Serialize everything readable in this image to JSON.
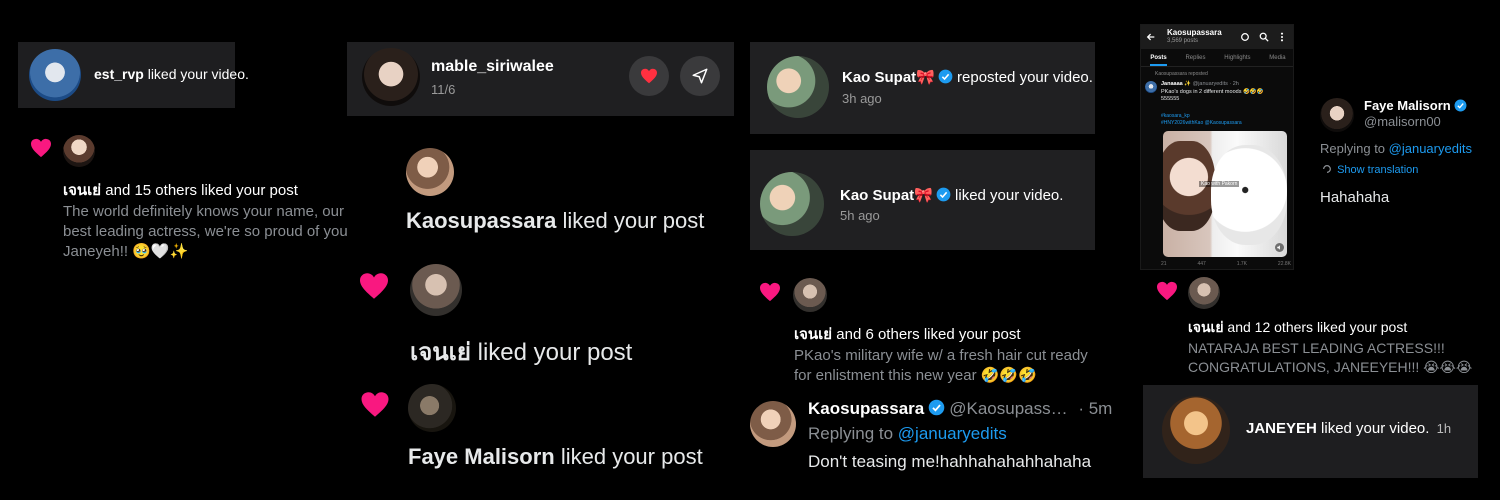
{
  "col1": {
    "toast": {
      "username": "est_rvp",
      "text": " liked your video."
    },
    "like": {
      "names": "เจนเย่",
      "rest": " and 15 others liked your post",
      "body_lines": [
        "The world definitely knows your name, our",
        "best leading actress, we're so proud of you",
        "Janeyeh!! 🥹🤍✨"
      ]
    }
  },
  "col2": {
    "dm": {
      "username": "mable_siriwalee",
      "date": "11/6"
    },
    "like1": {
      "name": "Kaosupassara",
      "rest": " liked your post"
    },
    "like2": {
      "name": "เจนเย่",
      "rest": " liked your post"
    },
    "like3": {
      "name": "Faye Malisorn",
      "rest": " liked your post"
    }
  },
  "col3": {
    "repost": {
      "name": "Kao Supat🎀",
      "rest": " reposted your video.",
      "time": "3h ago"
    },
    "liked": {
      "name": "Kao Supat🎀",
      "rest": " liked your video.",
      "time": "5h ago"
    },
    "like": {
      "names": "เจนเย่",
      "rest": " and 6 others liked your post",
      "body_lines": [
        "PKao's military wife w/ a fresh hair cut ready",
        "for enlistment this new year 🤣🤣🤣"
      ]
    },
    "reply": {
      "name": "Kaosupassara",
      "handle": "@Kaosupass…",
      "time": "· 5m",
      "replying": "Replying to ",
      "replying_handle": "@januaryedits",
      "text": "Don't teasing me!hahhahahahhahaha"
    }
  },
  "col4": {
    "profile": {
      "title": "Kaosupassara",
      "posts": "3,569 posts",
      "tabs": [
        "Posts",
        "Replies",
        "Highlights",
        "Media"
      ],
      "reposted": "Kaosupassara reposted",
      "author": "Janaaaa ✨",
      "author_meta": "@januaryedits · 2h",
      "tweet_lines": [
        "PKao's dogs in 2 different moods 🤣🤣🤣",
        "555555"
      ],
      "hashtags": [
        "#kaosara_kp",
        "#HNY2026withKao @Kaosupassara"
      ],
      "video_caption": "Kao with Pakorn",
      "stats": [
        "21",
        "447",
        "1.7K",
        "22.8K"
      ]
    },
    "reply": {
      "name": "Faye Malisorn",
      "handle": "@malisorn00",
      "replying": "Replying to ",
      "replying_handle": "@januaryedits",
      "show_translation": "Show translation",
      "text": "Hahahaha"
    },
    "like": {
      "names": "เจนเย่",
      "rest": " and 12 others liked your post",
      "body_lines": [
        "NATARAJA BEST LEADING ACTRESS!!!",
        "CONGRATULATIONS, JANEEYEH!!! 😭😭😭"
      ]
    },
    "toast": {
      "name": "JANEYEH",
      "rest": " liked your video.",
      "time": "1h"
    }
  },
  "colors": {
    "heart": "#f91880",
    "verified": "#1d9bf0",
    "card": "#1c1c1e"
  }
}
